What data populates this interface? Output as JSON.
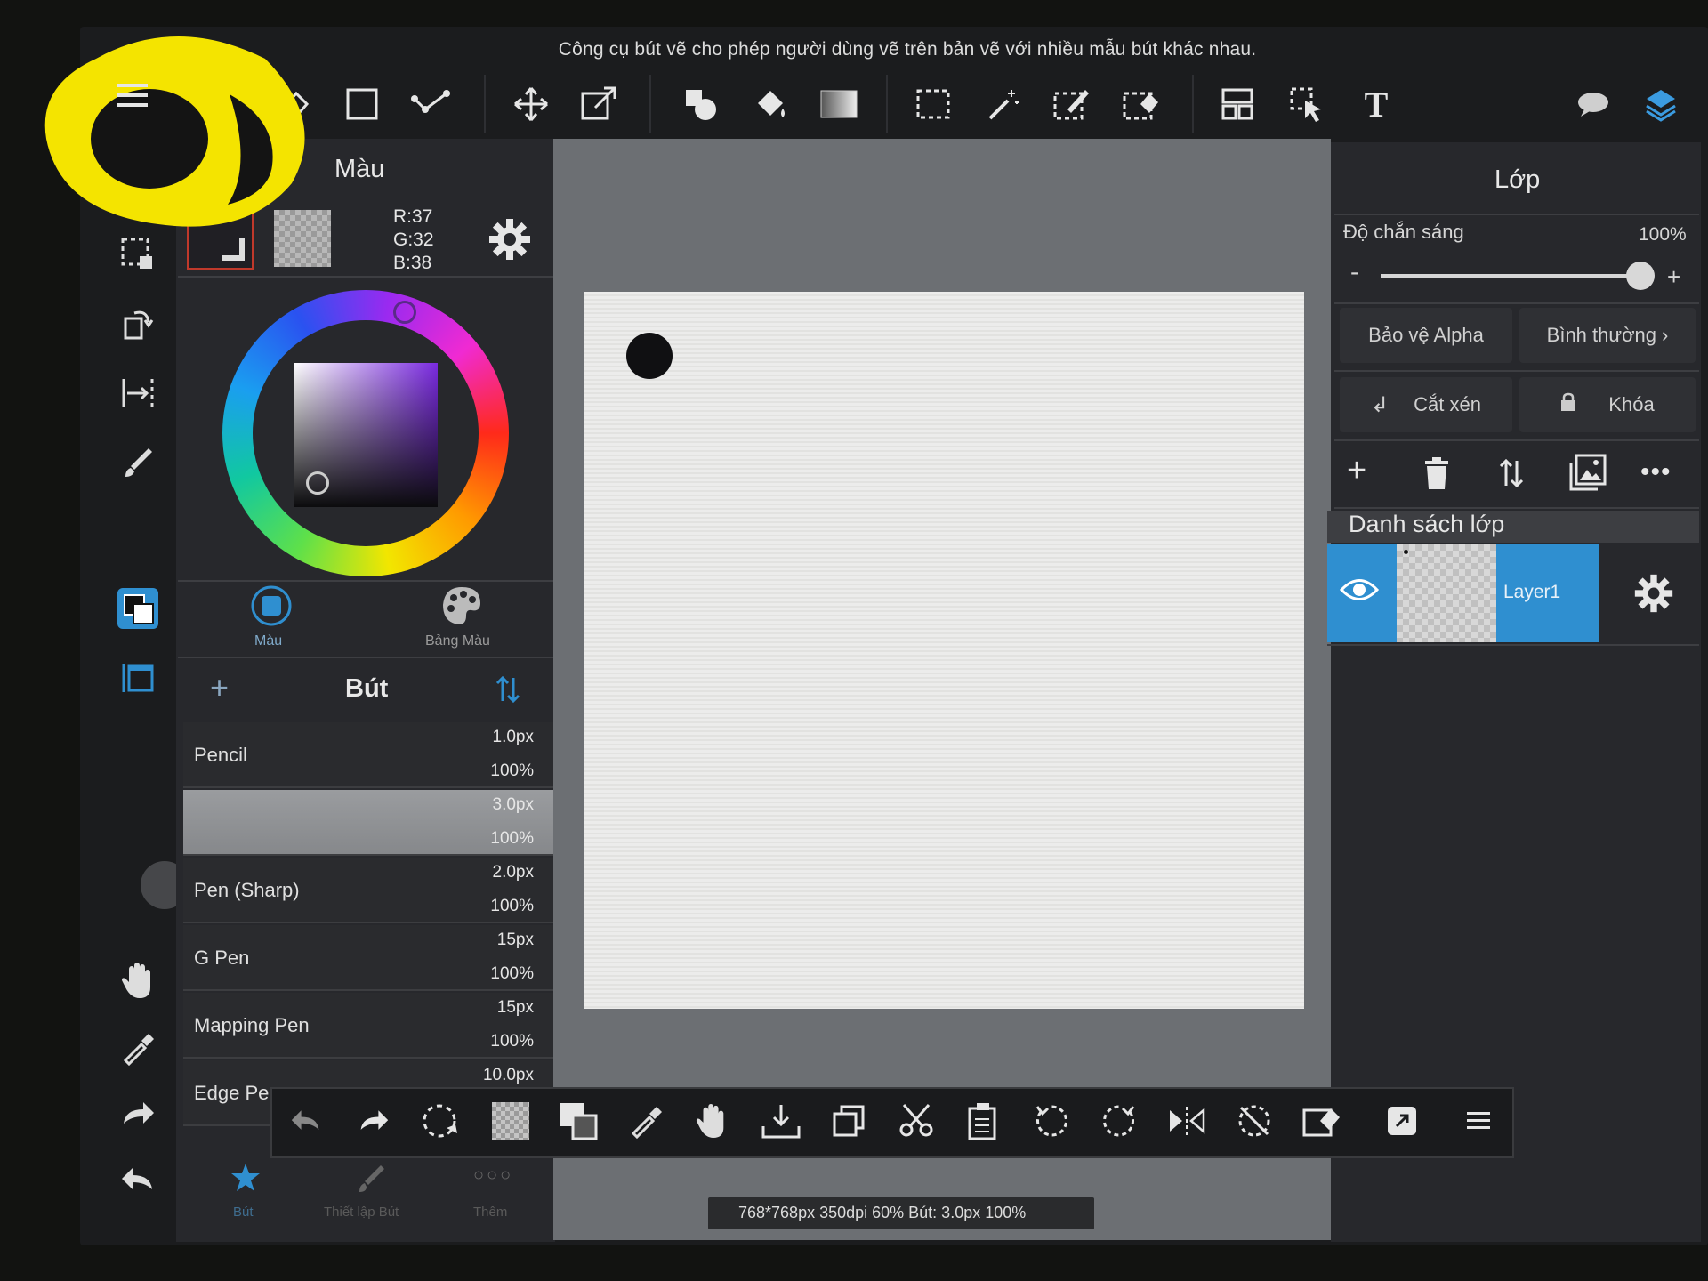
{
  "help_tip": "Công cụ bút vẽ cho phép người dùng vẽ trên bản vẽ với nhiều mẫu bút khác nhau.",
  "color_panel": {
    "title": "Màu",
    "rgb": {
      "r": "R:37",
      "g": "G:32",
      "b": "B:38"
    },
    "tabs": [
      "Màu",
      "Bảng Màu"
    ]
  },
  "brush_panel": {
    "title": "Bút",
    "brushes": [
      {
        "name": "Pencil",
        "size": "1.0px",
        "opacity": "100%"
      },
      {
        "name": "",
        "size": "3.0px",
        "opacity": "100%"
      },
      {
        "name": "Pen (Sharp)",
        "size": "2.0px",
        "opacity": "100%"
      },
      {
        "name": "G Pen",
        "size": "15px",
        "opacity": "100%"
      },
      {
        "name": "Mapping Pen",
        "size": "15px",
        "opacity": "100%"
      },
      {
        "name": "Edge Pe",
        "size": "10.0px",
        "opacity": ""
      }
    ],
    "bottom_tabs": [
      "Bút",
      "Thiết lập Bút",
      "Thêm"
    ]
  },
  "layer_panel": {
    "title": "Lớp",
    "opacity_label": "Độ chắn sáng",
    "opacity_value": "100%",
    "opacity_fraction": 1.0,
    "alpha_protect": "Bảo vệ Alpha",
    "blend_mode": "Bình thường",
    "clip": "Cắt xén",
    "lock": "Khóa",
    "list_title": "Danh sách lớp",
    "layers": [
      {
        "name": "Layer1"
      }
    ]
  },
  "status_bar": "768*768px 350dpi 60% Bút: 3.0px 100%",
  "accent_color": "#2f8fd0"
}
